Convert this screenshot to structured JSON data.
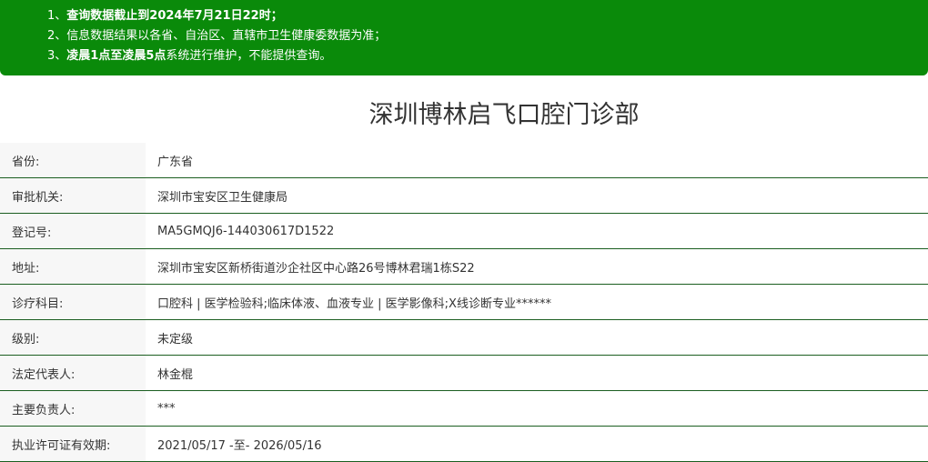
{
  "notice": {
    "line1": {
      "prefix": "1、",
      "text": "查询数据截止到2024年7月21日22时；"
    },
    "line2": {
      "prefix": "2、",
      "text": "信息数据结果以各省、自治区、直辖市卫生健康委数据为准；"
    },
    "line3": {
      "prefix": "3、",
      "bold": "凌晨1点至凌晨5点",
      "text": "系统进行维护，不能提供查询。"
    }
  },
  "title": "深圳博林启飞口腔门诊部",
  "rows": [
    {
      "label": "省份:",
      "value": "广东省"
    },
    {
      "label": "审批机关:",
      "value": "深圳市宝安区卫生健康局"
    },
    {
      "label": "登记号:",
      "value": "MA5GMQJ6-144030617D1522"
    },
    {
      "label": "地址:",
      "value": "深圳市宝安区新桥街道沙企社区中心路26号博林君瑞1栋S22"
    },
    {
      "label": "诊疗科目:",
      "value": "口腔科 | 医学检验科;临床体液、血液专业 | 医学影像科;X线诊断专业******"
    },
    {
      "label": "级别:",
      "value": "未定级"
    },
    {
      "label": "法定代表人:",
      "value": "林金棍"
    },
    {
      "label": "主要负责人:",
      "value": "***"
    },
    {
      "label": "执业许可证有效期:",
      "value": "2021/05/17 -至- 2026/05/16"
    }
  ],
  "colors": {
    "banner": "#0a8a0a",
    "row_border": "#1b5e20",
    "label_bg": "#f7f7f7"
  }
}
